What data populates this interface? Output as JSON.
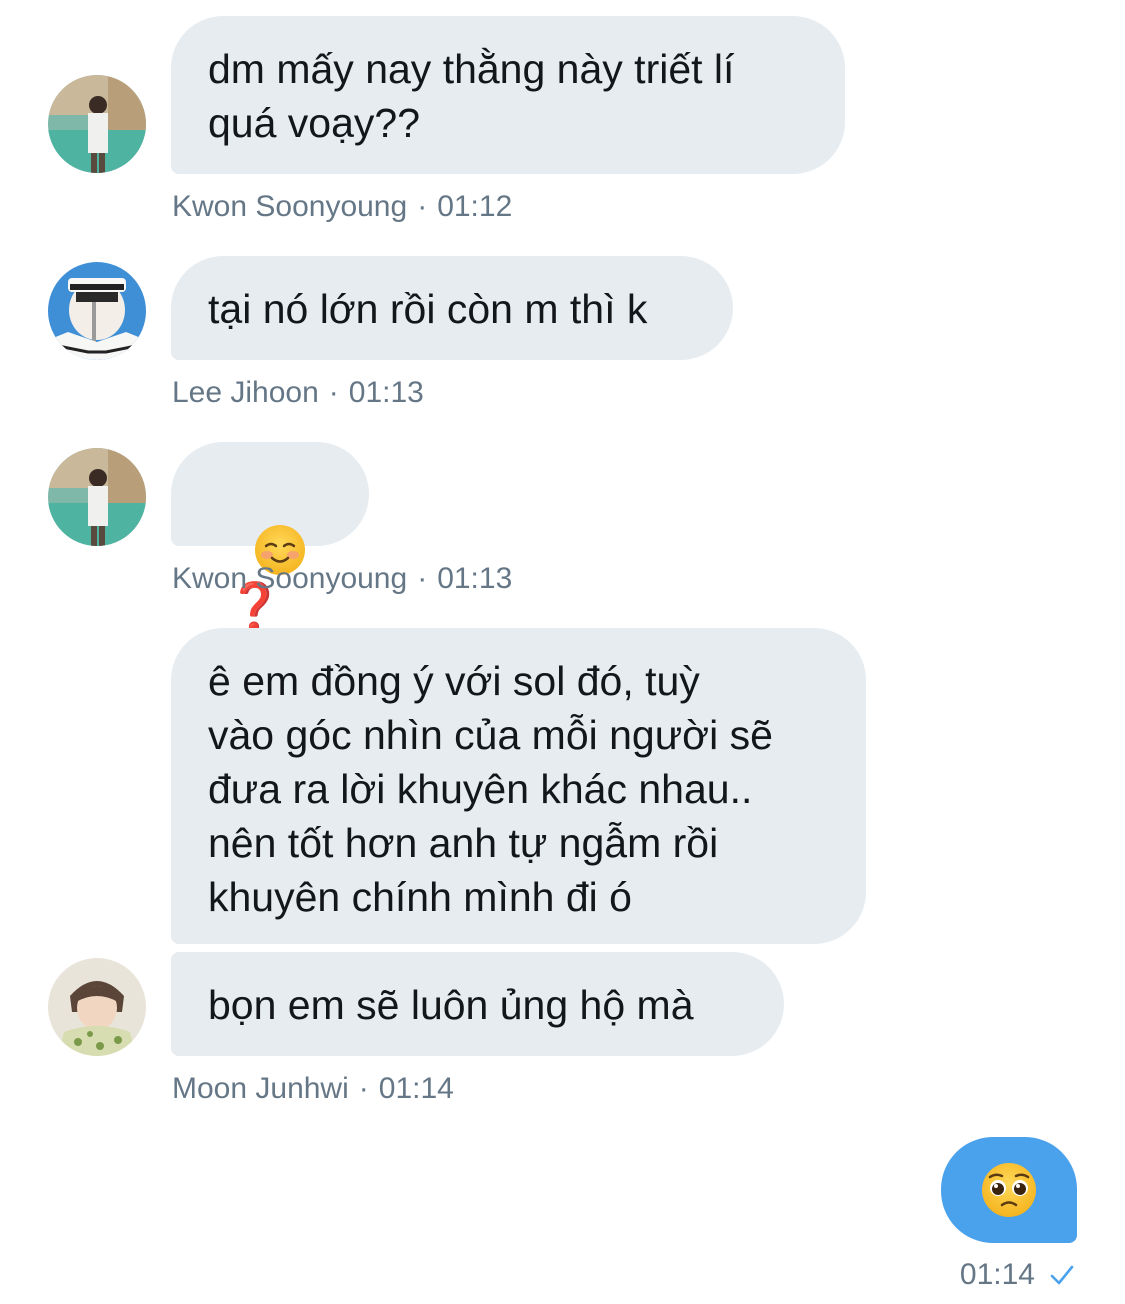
{
  "messages": [
    {
      "sender": "Kwon Soonyoung",
      "time": "01:12",
      "text": "dm mấy nay thằng này triết lí\nquá voạy??"
    },
    {
      "sender": "Lee Jihoon",
      "time": "01:13",
      "text": "tại nó lớn rồi còn m thì k"
    },
    {
      "sender": "Kwon Soonyoung",
      "time": "01:13",
      "emoji": "smiling-face-emoji",
      "text": "❓"
    },
    {
      "sender": "Moon Junhwi",
      "time": "01:14",
      "text_1": "ê em đồng ý với sol đó, tuỳ\nvào góc nhìn của mỗi người sẽ\nđưa ra lời khuyên khác nhau..\nnên tốt hơn anh tự ngẫm rồi\nkhuyên chính mình đi ó",
      "text_2": "bọn em sẽ luôn ủng hộ mà"
    }
  ],
  "outgoing": {
    "emoji": "pleading-face-emoji",
    "time": "01:14",
    "status_icon": "check-icon"
  },
  "meta_separator": "·",
  "colors": {
    "incoming_bubble": "#e6ecf0",
    "outgoing_bubble": "#4aa1ec",
    "meta_text": "#657786",
    "check": "#4aa1ec"
  }
}
